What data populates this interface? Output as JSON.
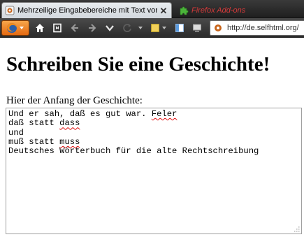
{
  "tabs": [
    {
      "label": "Mehrzeilige Eingabebereiche mit Text vorbelegen",
      "icon": "selfhtml-favicon",
      "active": true
    },
    {
      "label": "Firefox Add-ons",
      "icon": "puzzle-piece-icon",
      "active": false
    }
  ],
  "toolbar": {
    "firefox_menu_icon": "firefox-logo",
    "url": "http://de.selfhtml.org/"
  },
  "page": {
    "title": "Schreiben Sie eine Geschichte!",
    "textarea_label": "Hier der Anfang der Geschichte:",
    "textarea_lines": [
      [
        "Und er sah, daß es gut war. ",
        {
          "err": "Feler"
        }
      ],
      [
        "daß statt ",
        {
          "err": "dass"
        }
      ],
      [
        "und"
      ],
      [
        "muß statt ",
        {
          "err": "muss"
        }
      ],
      [
        "Deutsches Wörterbuch für die alte Rechtschreibung"
      ]
    ]
  },
  "colors": {
    "inactive_tab_text": "#d63a3a",
    "spellcheck_underline": "#e01010",
    "firefox_button": "#e56a12"
  }
}
